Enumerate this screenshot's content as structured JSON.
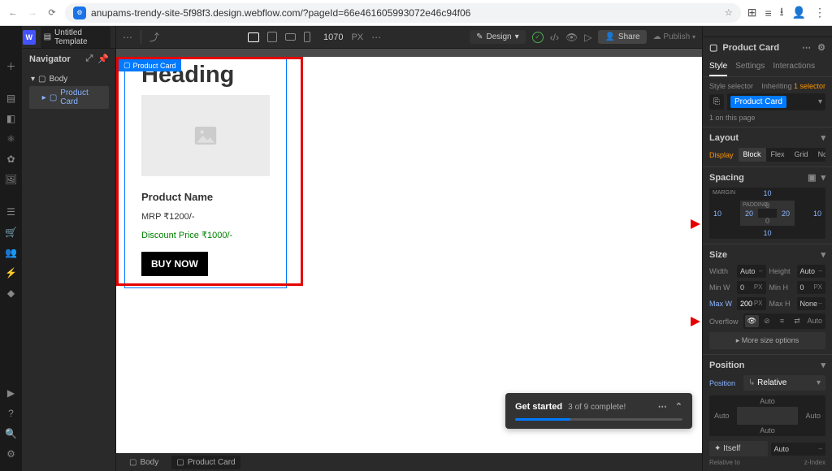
{
  "browser": {
    "url": "anupams-trendy-site-5f98f3.design.webflow.com/?pageId=66e461605993072e46c94f06"
  },
  "topbar": {
    "page_name": "Untitled Template",
    "canvas_width": "1070",
    "canvas_unit": "PX",
    "design_label": "Design",
    "share_label": "Share",
    "publish_label": "Publish"
  },
  "navigator": {
    "title": "Navigator",
    "items": [
      {
        "label": "Body"
      },
      {
        "label": "Product Card",
        "selected": true
      }
    ]
  },
  "canvas": {
    "selected_tag": "Product Card",
    "card": {
      "heading": "Heading",
      "product_name": "Product Name",
      "mrp": "MRP ₹1200/-",
      "discount": "Discount Price ₹1000/-",
      "button": "BUY NOW"
    }
  },
  "breadcrumb": {
    "body": "Body",
    "item": "Product Card"
  },
  "toast": {
    "title": "Get started",
    "subtitle": "3 of 9 complete!"
  },
  "inspector": {
    "element": "Product Card",
    "tabs": {
      "style": "Style",
      "settings": "Settings",
      "interactions": "Interactions"
    },
    "style_selector_label": "Style selector",
    "inheriting_label": "Inheriting",
    "inheriting_count": "1 selector",
    "class_chip": "Product Card",
    "on_page": "1 on this page",
    "layout": {
      "title": "Layout",
      "display_label": "Display",
      "options": {
        "block": "Block",
        "flex": "Flex",
        "grid": "Grid",
        "none": "None"
      }
    },
    "spacing": {
      "title": "Spacing",
      "margin_label": "MARGIN",
      "padding_label": "PADDING",
      "margin": {
        "top": "10",
        "right": "10",
        "bottom": "10",
        "left": "10"
      },
      "padding": {
        "top": "0",
        "right": "20",
        "bottom": "0",
        "left": "20"
      }
    },
    "size": {
      "title": "Size",
      "width_label": "Width",
      "width_val": "Auto",
      "height_label": "Height",
      "height_val": "Auto",
      "minw_label": "Min W",
      "minw_val": "0",
      "minw_unit": "PX",
      "minh_label": "Min H",
      "minh_val": "0",
      "minh_unit": "PX",
      "maxw_label": "Max W",
      "maxw_val": "200",
      "maxw_unit": "PX",
      "maxh_label": "Max H",
      "maxh_val": "None",
      "overflow_label": "Overflow",
      "overflow_auto": "Auto",
      "more": "More size options"
    },
    "position": {
      "title": "Position",
      "label": "Position",
      "value": "Relative",
      "auto": "Auto",
      "itself": "Itself",
      "relative_to": "Relative to",
      "zindex": "z-Index"
    }
  }
}
